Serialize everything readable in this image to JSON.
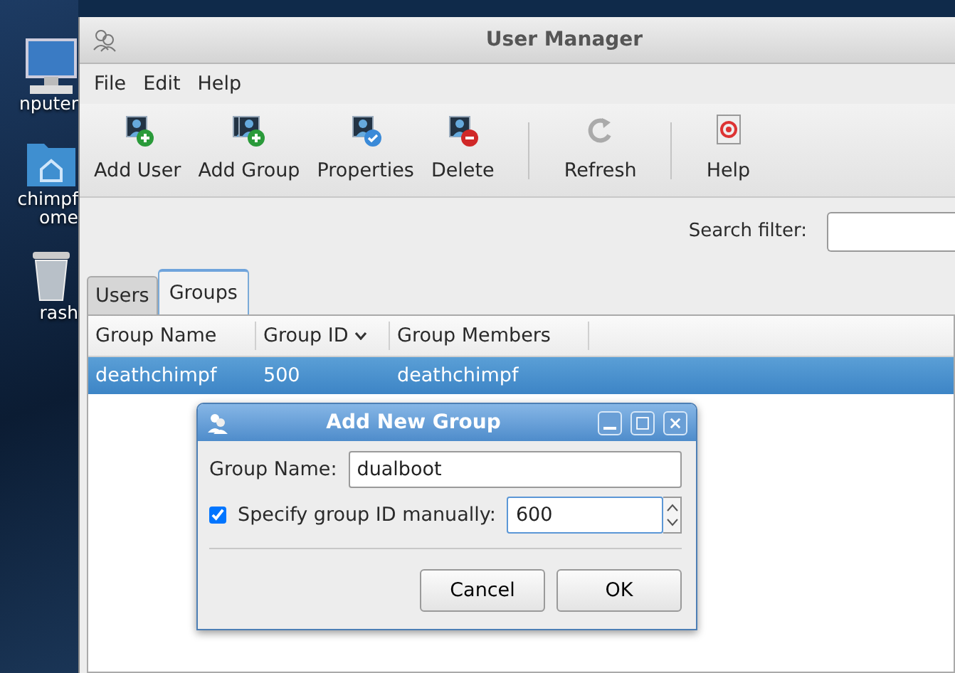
{
  "desktop_icons": [
    {
      "kind": "computer",
      "lines": [
        "nputer"
      ]
    },
    {
      "kind": "home",
      "lines": [
        "chimpf",
        "ome"
      ]
    },
    {
      "kind": "trash",
      "lines": [
        "rash"
      ]
    }
  ],
  "window": {
    "title": "User Manager"
  },
  "menu": [
    "File",
    "Edit",
    "Help"
  ],
  "toolbar": [
    {
      "kind": "add-user",
      "label": "Add User",
      "separator_before": false
    },
    {
      "kind": "add-group",
      "label": "Add Group",
      "separator_before": false
    },
    {
      "kind": "properties",
      "label": "Properties",
      "separator_before": false
    },
    {
      "kind": "delete",
      "label": "Delete",
      "separator_before": false
    },
    {
      "kind": "refresh",
      "label": "Refresh",
      "separator_before": true
    },
    {
      "kind": "help",
      "label": "Help",
      "separator_before": true
    }
  ],
  "search": {
    "label": "Search filter:"
  },
  "tabs": [
    {
      "label": "Users",
      "selected": false
    },
    {
      "label": "Groups",
      "selected": true
    }
  ],
  "table": {
    "columns": [
      {
        "label": "Group Name",
        "sorted": false
      },
      {
        "label": "Group ID",
        "sorted": true
      },
      {
        "label": "Group Members",
        "sorted": false
      }
    ],
    "rows": [
      {
        "cells": [
          "deathchimpf",
          "500",
          "deathchimpf"
        ],
        "selected": true
      }
    ]
  },
  "dialog": {
    "title": "Add New Group",
    "name_label": "Group Name:",
    "name_value": "dualboot",
    "id_label": "Specify group ID manually:",
    "id_checked": true,
    "id_value": "600",
    "buttons": [
      "Cancel",
      "OK"
    ]
  }
}
